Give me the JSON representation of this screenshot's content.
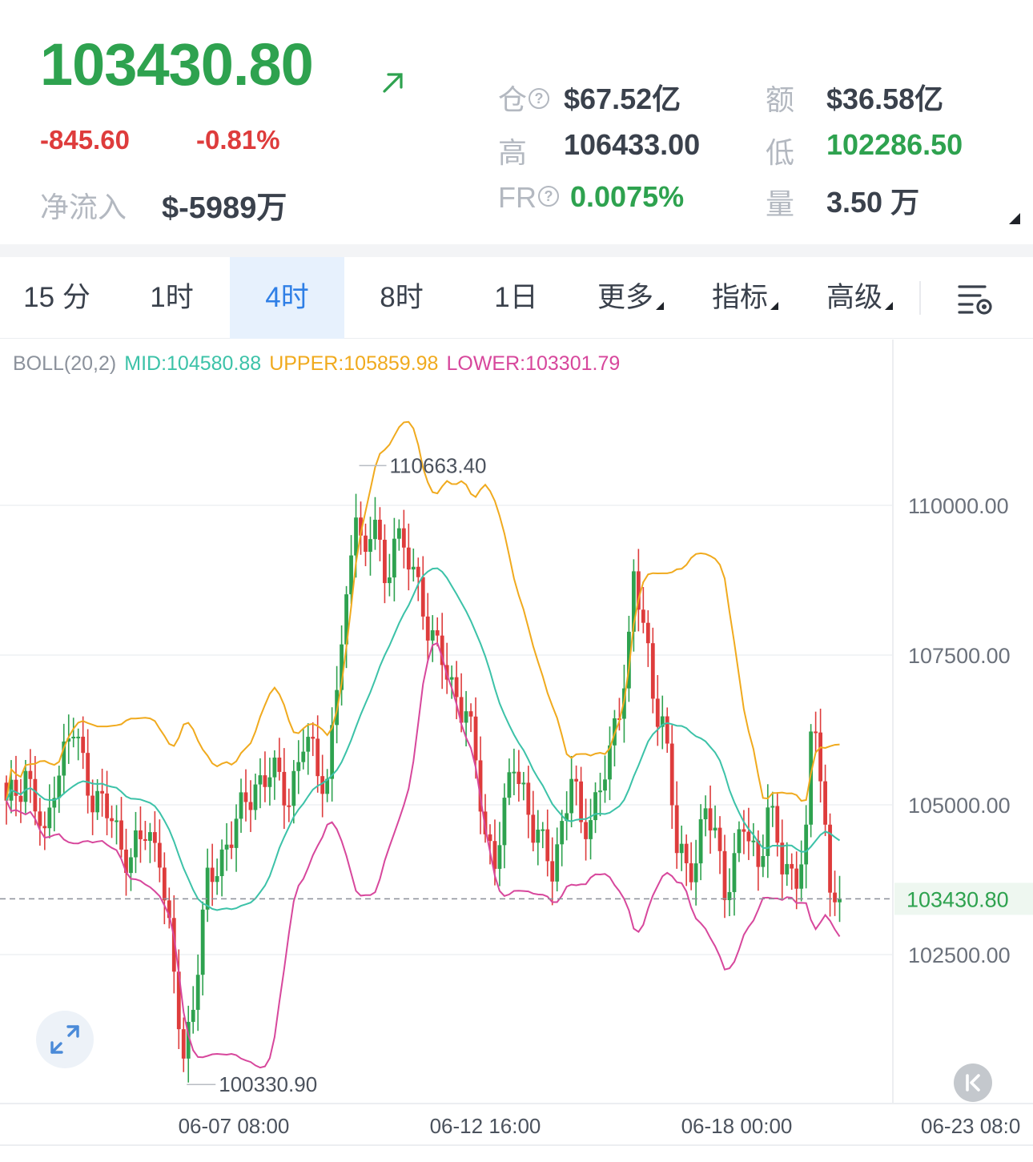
{
  "ticker": {
    "price": "103430.80",
    "change": "-845.60",
    "change_pct": "-0.81%",
    "netflow_label": "净流入",
    "netflow_value": "$-5989万"
  },
  "stats": {
    "open_interest": {
      "label": "仓",
      "value": "$67.52亿"
    },
    "amount": {
      "label": "额",
      "value": "$36.58亿"
    },
    "high": {
      "label": "高",
      "value": "106433.00"
    },
    "low": {
      "label": "低",
      "value": "102286.50"
    },
    "funding_rate": {
      "label": "FR",
      "value": "0.0075%"
    },
    "volume": {
      "label": "量",
      "value": "3.50 万"
    }
  },
  "tabs": [
    {
      "label": "15 分"
    },
    {
      "label": "1时"
    },
    {
      "label": "4时",
      "active": true
    },
    {
      "label": "8时"
    },
    {
      "label": "1日"
    },
    {
      "label": "更多"
    },
    {
      "label": "指标"
    },
    {
      "label": "高级"
    }
  ],
  "indicator": {
    "name": "BOLL(20,2)",
    "mid": "MID:104580.88",
    "upper": "UPPER:105859.98",
    "lower": "LOWER:103301.79"
  },
  "colors": {
    "up": "#2ea24f",
    "down": "#de3c3c",
    "mid": "#3cc2a8",
    "upper": "#f0aa1e",
    "lower": "#d7479c"
  },
  "icons": {
    "trend": "arrow-up-right-icon",
    "help": "question-circle-icon",
    "settings": "chart-settings-icon",
    "fullscreen": "expand-icon",
    "back": "skip-to-latest-icon"
  },
  "chart_data": {
    "type": "candlestick",
    "interval": "4h",
    "ylim": [
      99200,
      113200
    ],
    "y_ticks": [
      "110000.00",
      "107500.00",
      "105000.00",
      "102500.00"
    ],
    "x_ticks": [
      "06-07 08:00",
      "06-12 16:00",
      "06-18 00:00",
      "06-23 08:0"
    ],
    "last_price": "103430.80",
    "max_label": "110663.40",
    "min_label": "100330.90",
    "anchors": [
      [
        0,
        104900
      ],
      [
        4,
        105600
      ],
      [
        8,
        104300
      ],
      [
        10,
        105500
      ],
      [
        14,
        106200
      ],
      [
        18,
        105200
      ],
      [
        22,
        104700
      ],
      [
        26,
        104100
      ],
      [
        29,
        104500
      ],
      [
        32,
        104300
      ],
      [
        35,
        102000
      ],
      [
        37,
        100800
      ],
      [
        39,
        101800
      ],
      [
        42,
        103600
      ],
      [
        46,
        104400
      ],
      [
        49,
        104800
      ],
      [
        52,
        105400
      ],
      [
        55,
        105500
      ],
      [
        59,
        105200
      ],
      [
        62,
        106000
      ],
      [
        64,
        105800
      ],
      [
        67,
        105400
      ],
      [
        69,
        107000
      ],
      [
        71,
        108200
      ],
      [
        73,
        110200
      ],
      [
        75,
        109000
      ],
      [
        77,
        109800
      ],
      [
        79,
        108600
      ],
      [
        81,
        109700
      ],
      [
        83,
        109100
      ],
      [
        85,
        108900
      ],
      [
        88,
        108100
      ],
      [
        90,
        107500
      ],
      [
        93,
        107000
      ],
      [
        96,
        106600
      ],
      [
        98,
        105600
      ],
      [
        100,
        104500
      ],
      [
        102,
        104200
      ],
      [
        104,
        104800
      ],
      [
        106,
        105700
      ],
      [
        108,
        105300
      ],
      [
        110,
        104600
      ],
      [
        112,
        104200
      ],
      [
        114,
        104000
      ],
      [
        116,
        104700
      ],
      [
        118,
        105400
      ],
      [
        120,
        104600
      ],
      [
        122,
        104900
      ],
      [
        124,
        105300
      ],
      [
        126,
        105700
      ],
      [
        128,
        106700
      ],
      [
        130,
        107800
      ],
      [
        131,
        108800
      ],
      [
        133,
        107900
      ],
      [
        135,
        106900
      ],
      [
        137,
        106500
      ],
      [
        138,
        105800
      ],
      [
        140,
        104200
      ],
      [
        142,
        104000
      ],
      [
        144,
        104200
      ],
      [
        146,
        104800
      ],
      [
        148,
        104500
      ],
      [
        150,
        103700
      ],
      [
        152,
        104000
      ],
      [
        154,
        104600
      ],
      [
        157,
        104100
      ],
      [
        159,
        104900
      ],
      [
        162,
        104000
      ],
      [
        165,
        103900
      ],
      [
        167,
        104300
      ],
      [
        168,
        106000
      ],
      [
        169,
        106400
      ],
      [
        170,
        105500
      ],
      [
        172,
        103700
      ],
      [
        174,
        103430.8
      ]
    ]
  }
}
